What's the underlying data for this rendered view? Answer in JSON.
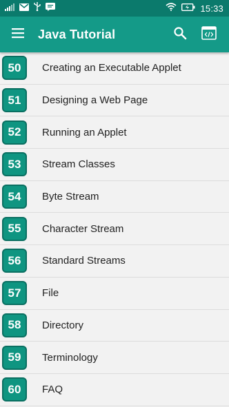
{
  "status_bar": {
    "time": "15:33",
    "icons": [
      "signal-icon",
      "mail-icon",
      "usb-icon",
      "chat-icon",
      "wifi-icon",
      "battery-charging-icon"
    ]
  },
  "app_bar": {
    "title": "Java Tutorial",
    "icons": [
      "menu-icon",
      "search-icon",
      "code-icon"
    ]
  },
  "colors": {
    "status_bar": "#0b7a6c",
    "app_bar": "#149a88",
    "badge": "#0f9581",
    "badge_border": "#0a6f61"
  },
  "topics": [
    {
      "number": "50",
      "title": "Creating an Executable Applet"
    },
    {
      "number": "51",
      "title": "Designing a Web Page"
    },
    {
      "number": "52",
      "title": "Running an Applet"
    },
    {
      "number": "53",
      "title": "Stream Classes"
    },
    {
      "number": "54",
      "title": "Byte Stream"
    },
    {
      "number": "55",
      "title": "Character Stream"
    },
    {
      "number": "56",
      "title": "Standard Streams"
    },
    {
      "number": "57",
      "title": "File"
    },
    {
      "number": "58",
      "title": "Directory"
    },
    {
      "number": "59",
      "title": "Terminology"
    },
    {
      "number": "60",
      "title": "FAQ"
    }
  ]
}
